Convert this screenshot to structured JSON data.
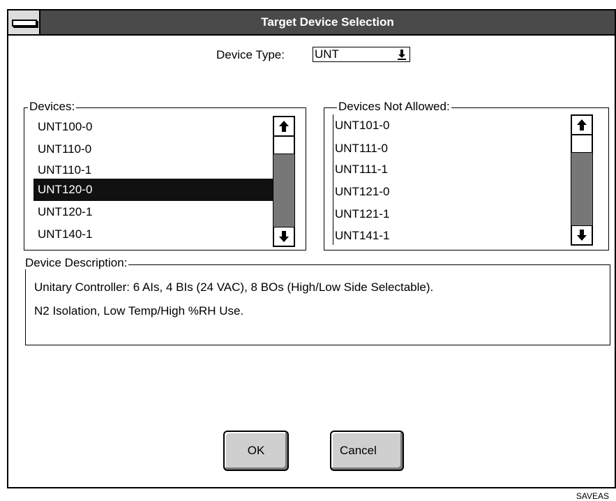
{
  "window": {
    "title": "Target Device Selection"
  },
  "device_type": {
    "label": "Device Type:",
    "value": "UNT"
  },
  "devices": {
    "label": "Devices:",
    "items": [
      "UNT100-0",
      "UNT110-0",
      "UNT110-1",
      "UNT120-0",
      "UNT120-1",
      "UNT140-1"
    ],
    "selected": "UNT120-0"
  },
  "devices_not_allowed": {
    "label": "Devices Not Allowed:",
    "items": [
      "UNT101-0",
      "UNT111-0",
      "UNT111-1",
      "UNT121-0",
      "UNT121-1",
      "UNT141-1"
    ]
  },
  "description": {
    "label": "Device Description:",
    "lines": [
      "Unitary Controller: 6 AIs, 4 BIs (24 VAC), 8 BOs (High/Low Side Selectable).",
      "N2 Isolation, Low Temp/High %RH Use."
    ]
  },
  "buttons": {
    "ok": "OK",
    "cancel": "Cancel"
  },
  "footer": {
    "caption": "SAVEAS"
  },
  "icons": {
    "scroll_up": "up-arrow-icon",
    "scroll_down": "down-arrow-icon",
    "dropdown": "dropdown-arrow-icon",
    "system_menu": "system-menu-icon"
  }
}
